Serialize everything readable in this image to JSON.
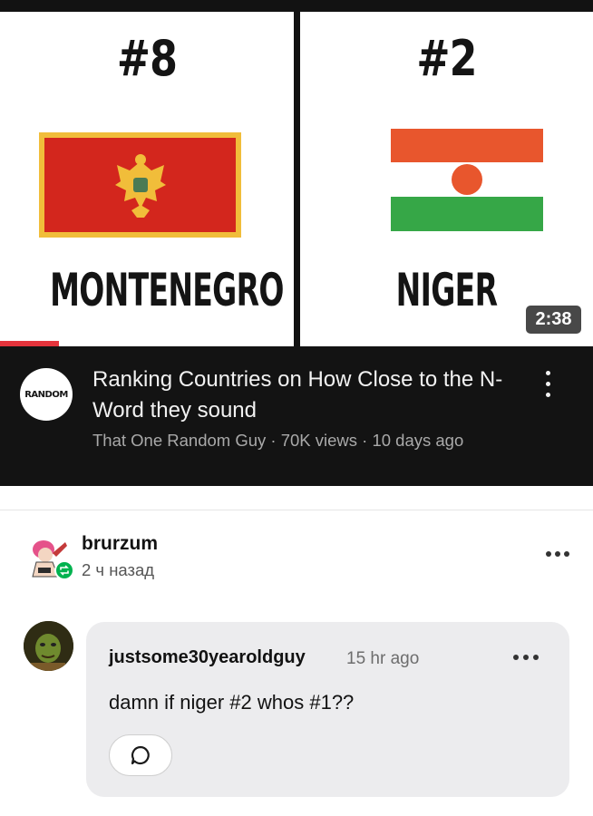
{
  "video": {
    "thumbnail": {
      "left_rank": "#8",
      "left_country": "MONTENEGRO",
      "right_rank": "#2",
      "right_country": "NIGER",
      "duration": "2:38",
      "watched_progress_percent": 10
    },
    "channel_avatar_text": "RANDOM",
    "title": "Ranking Countries on How Close to the N-Word they sound",
    "meta": "That One Random Guy · 70K views · 10 days ago"
  },
  "post": {
    "username": "brurzum",
    "time": "2 ч назад"
  },
  "comment": {
    "username": "justsome30yearoldguy",
    "time": "15 hr ago",
    "text": "damn if niger #2 whos #1??"
  },
  "colors": {
    "video_bar": "#131313",
    "progress": "#e5343c",
    "reblog_badge": "#00b24f",
    "comment_bubble": "#ececee"
  },
  "icons": [
    "kebab-menu-icon",
    "reblog-icon",
    "more-dots-icon",
    "reply-bubble-icon"
  ]
}
